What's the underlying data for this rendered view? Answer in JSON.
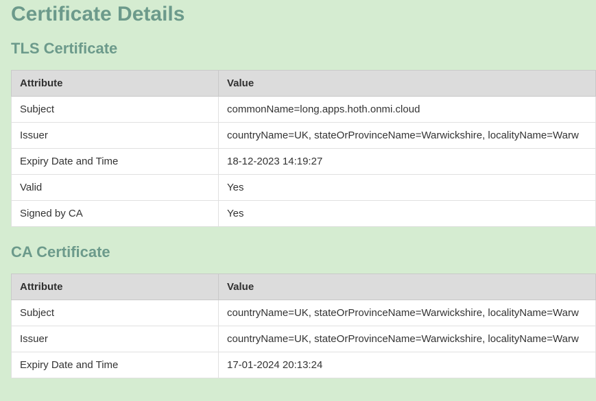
{
  "page": {
    "title": "Certificate Details"
  },
  "headers": {
    "attribute": "Attribute",
    "value": "Value"
  },
  "tls": {
    "title": "TLS Certificate",
    "rows": [
      {
        "attr": "Subject",
        "val": "commonName=long.apps.hoth.onmi.cloud"
      },
      {
        "attr": "Issuer",
        "val": "countryName=UK, stateOrProvinceName=Warwickshire, localityName=Warw"
      },
      {
        "attr": "Expiry Date and Time",
        "val": "18-12-2023 14:19:27"
      },
      {
        "attr": "Valid",
        "val": "Yes"
      },
      {
        "attr": "Signed by CA",
        "val": "Yes"
      }
    ]
  },
  "ca": {
    "title": "CA Certificate",
    "rows": [
      {
        "attr": "Subject",
        "val": "countryName=UK, stateOrProvinceName=Warwickshire, localityName=Warw"
      },
      {
        "attr": "Issuer",
        "val": "countryName=UK, stateOrProvinceName=Warwickshire, localityName=Warw"
      },
      {
        "attr": "Expiry Date and Time",
        "val": "17-01-2024 20:13:24"
      }
    ]
  }
}
